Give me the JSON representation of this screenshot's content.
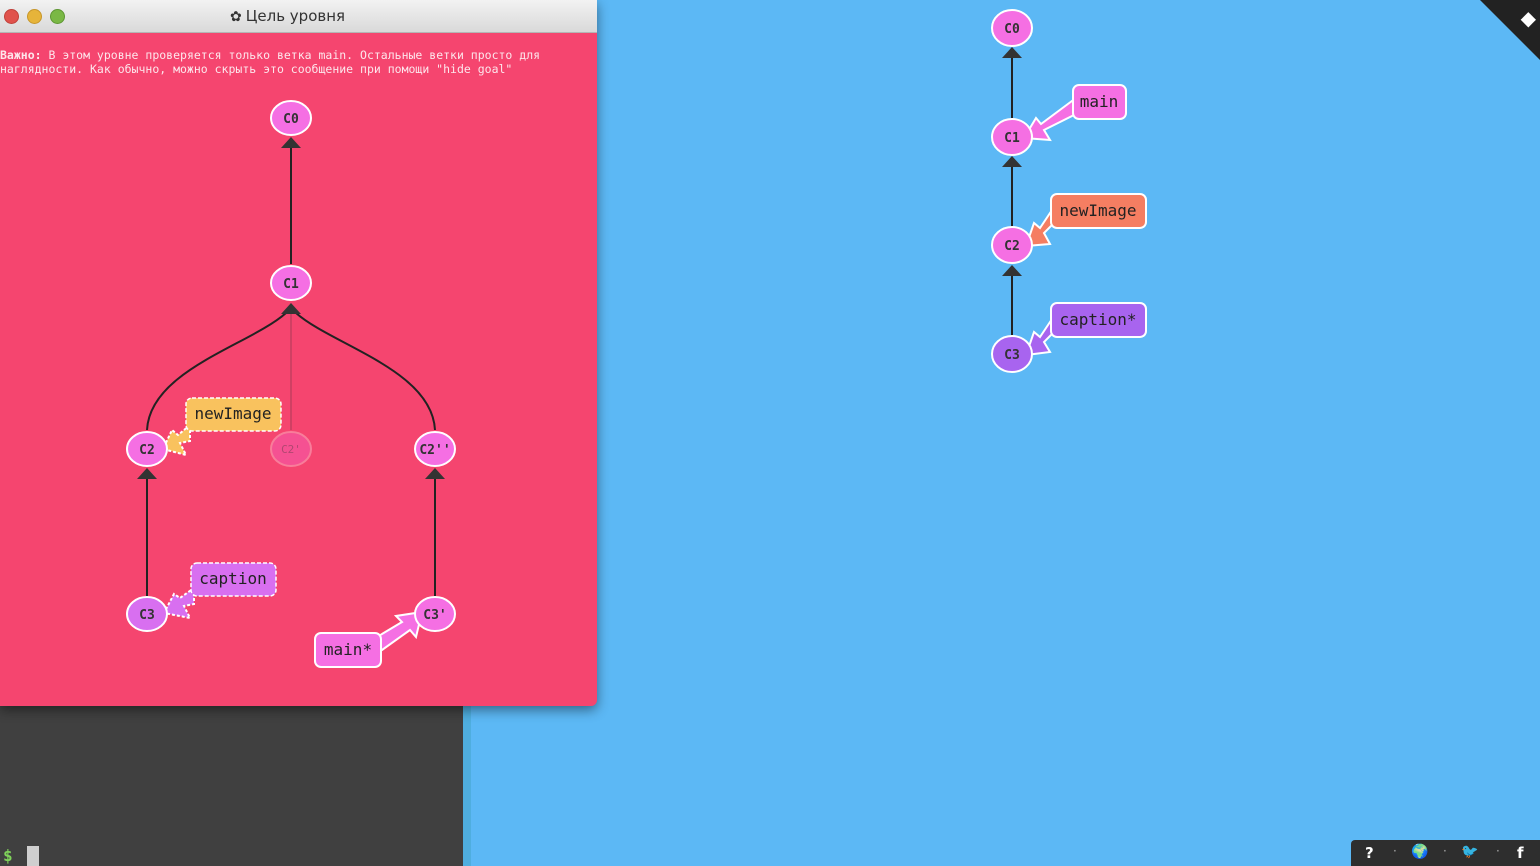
{
  "goal_window": {
    "title": "Цель уровня",
    "title_icon": "gear-icon",
    "note_bold": "Важно:",
    "note_text": " В этом уровне проверяется только ветка main. Остальные ветки просто для\nнаглядности. Как обычно, можно скрыть это сообщение при помощи \"hide goal\"",
    "commits": [
      "C0",
      "C1",
      "C2",
      "C2'",
      "C2''",
      "C3",
      "C3'"
    ],
    "branches": [
      "newImage",
      "caption",
      "main*"
    ]
  },
  "main_tree": {
    "commits": [
      "C0",
      "C1",
      "C2",
      "C3"
    ],
    "branches": [
      "main",
      "newImage",
      "caption*"
    ]
  },
  "terminal": {
    "prompt": "$"
  },
  "toolbar": {
    "help": "?",
    "globe": "🌍",
    "twitter": "🐦",
    "facebook": "f"
  },
  "colors": {
    "background": "#5cb8f5",
    "goal_bg": "#f5456f",
    "commit_pink": "#f56fe3",
    "commit_purple": "#a864ef",
    "branch_pink": "#f56fe3",
    "branch_orange": "#f57e62",
    "branch_purple": "#a864ef",
    "branch_yellow": "#f9c25e",
    "terminal_bg": "#404040"
  }
}
